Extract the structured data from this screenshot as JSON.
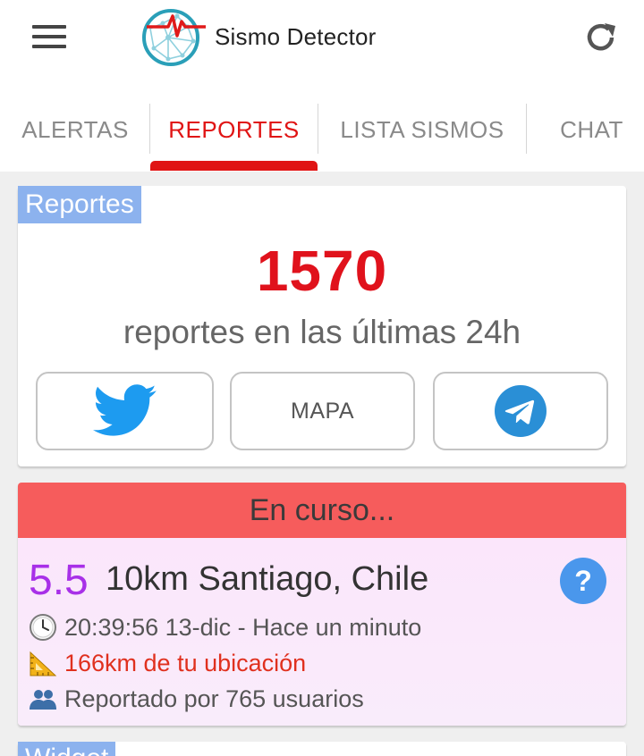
{
  "app": {
    "title": "Sismo Detector"
  },
  "tabs": [
    {
      "label": "ALERTAS",
      "active": false
    },
    {
      "label": "REPORTES",
      "active": true
    },
    {
      "label": "LISTA SISMOS",
      "active": false
    },
    {
      "label": "CHAT",
      "active": false
    }
  ],
  "reportes": {
    "tag": "Reportes",
    "count": "1570",
    "subtitle": "reportes en las últimas 24h",
    "buttons": {
      "twitter_icon": "twitter-bird-icon",
      "map_label": "MAPA",
      "telegram_icon": "telegram-plane-icon"
    }
  },
  "en_curso": {
    "header": "En curso...",
    "magnitude": "5.5",
    "place": "10km Santiago, Chile",
    "help_label": "?",
    "time": "20:39:56 13-dic - Hace un minuto",
    "distance": "166km de tu ubicación",
    "reported": "Reportado por 765 usuarios"
  },
  "widget": {
    "tag": "Widget"
  },
  "colors": {
    "accent_red": "#e01414",
    "tag_blue": "#8cb2ee",
    "header_red": "#f65c5c",
    "magnitude_purple": "#a830e8",
    "help_blue": "#4a97ec",
    "twitter_blue": "#1d9bf0",
    "telegram_blue": "#2a8fd6"
  }
}
